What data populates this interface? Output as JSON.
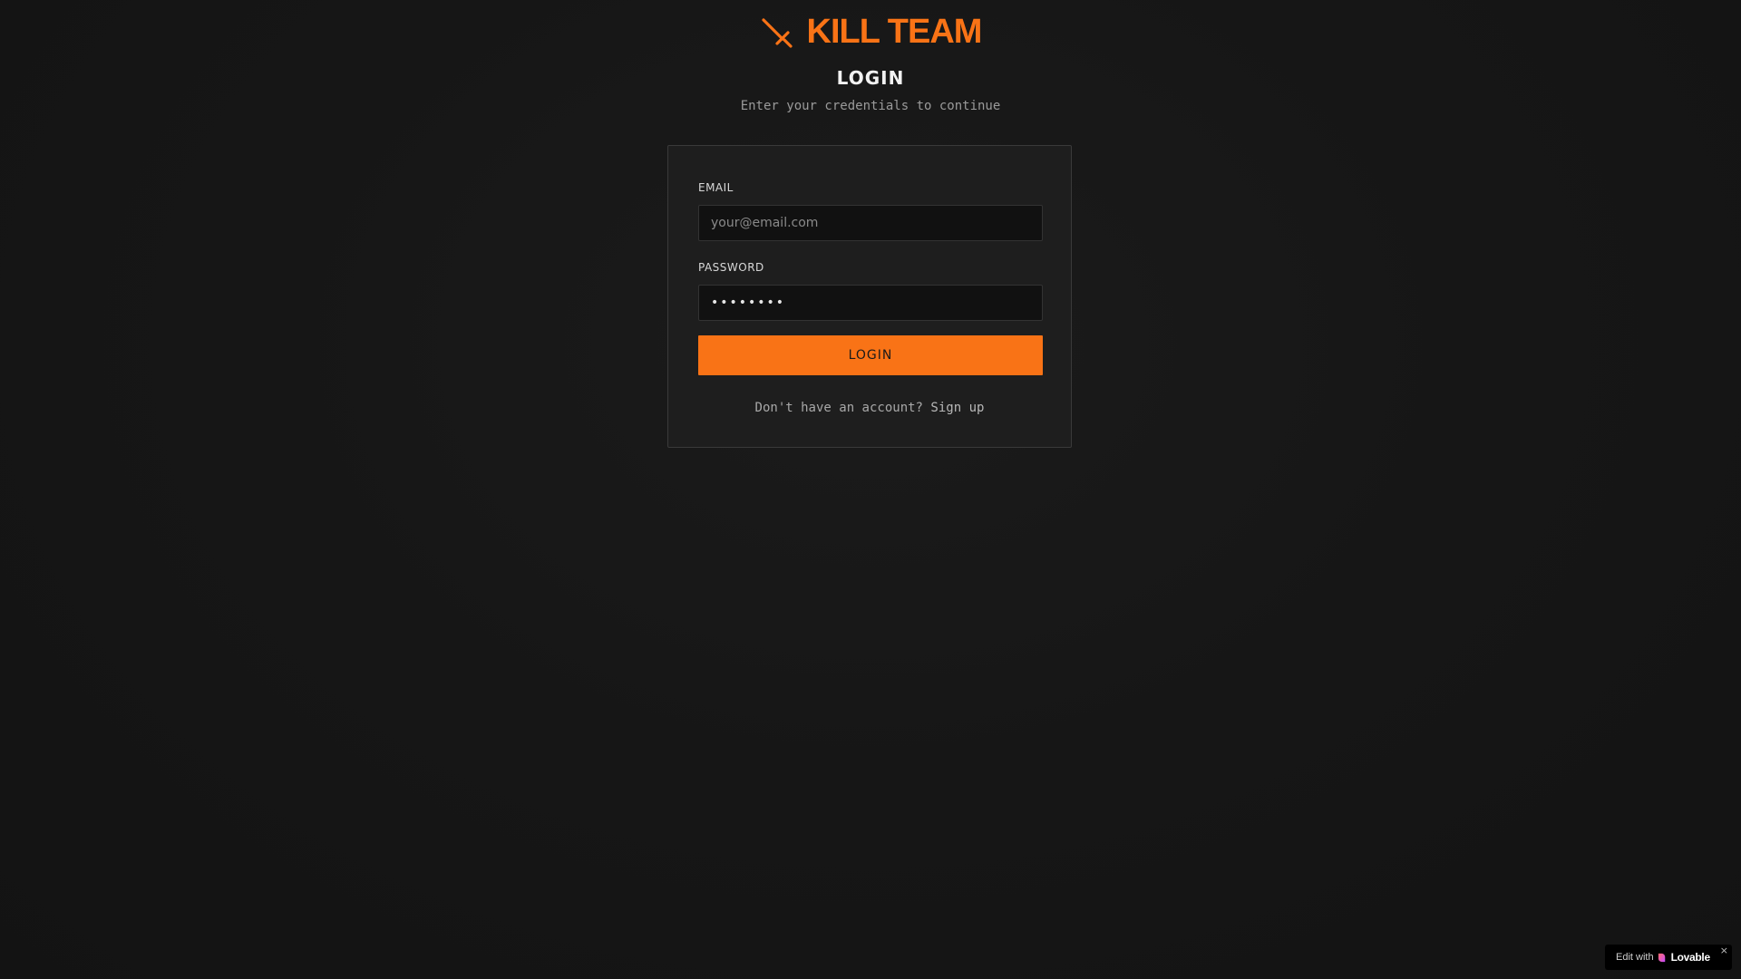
{
  "brand": {
    "name": "KILL TEAM",
    "icon": "sword-icon",
    "accent_color": "#f97316"
  },
  "header": {
    "title": "LOGIN",
    "subtitle": "Enter your credentials to continue"
  },
  "form": {
    "email": {
      "label": "EMAIL",
      "placeholder": "your@email.com",
      "value": ""
    },
    "password": {
      "label": "PASSWORD",
      "value": "••••••••"
    },
    "submit_label": "LOGIN",
    "signup_prompt": "Don't have an account?",
    "signup_link": "Sign up"
  },
  "badge": {
    "prefix": "Edit with",
    "brand": "Lovable",
    "icon": "heart-icon",
    "close_label": "×"
  }
}
